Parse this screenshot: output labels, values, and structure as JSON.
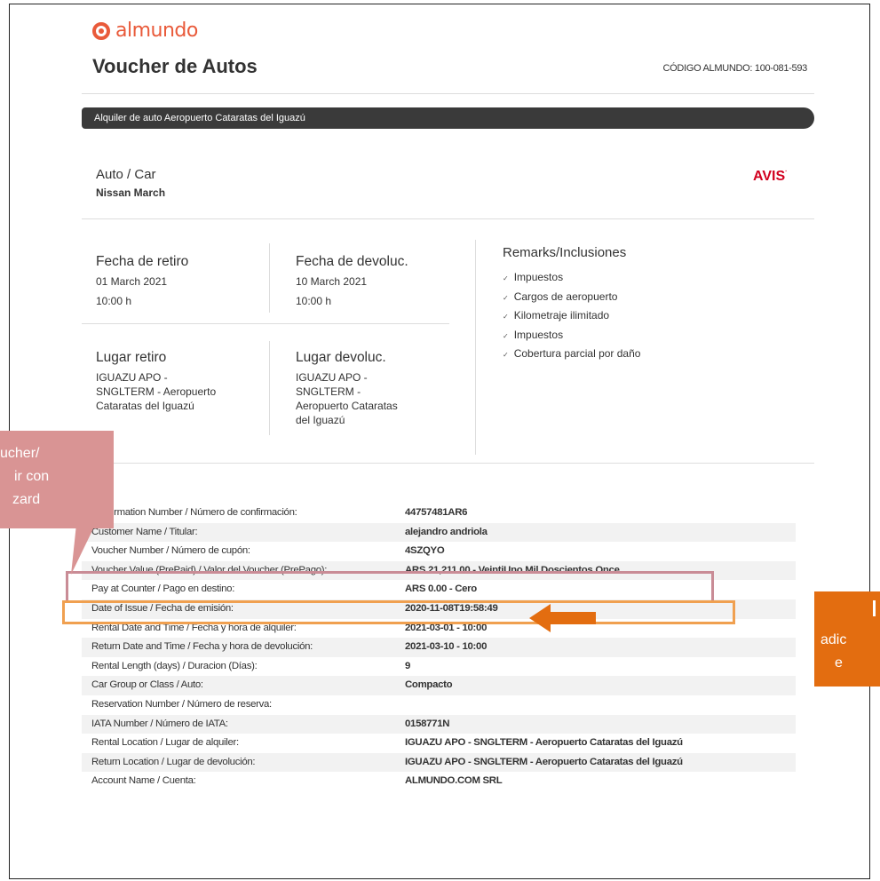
{
  "brand": {
    "name": "almundo"
  },
  "header": {
    "title": "Voucher de Autos",
    "code": "CÓDIGO ALMUNDO: 100-081-593"
  },
  "bar_title": "Alquiler de auto Aeropuerto Cataratas del Iguazú",
  "car": {
    "heading": "Auto / Car",
    "model": "Nissan March",
    "company": "AVIS"
  },
  "pickup": {
    "heading": "Fecha de retiro",
    "date": "01 March 2021",
    "time": "10:00 h",
    "place_heading": "Lugar retiro",
    "place": "IGUAZU APO -\nSNGLTERM - Aeropuerto\nCataratas del Iguazú"
  },
  "return": {
    "heading": "Fecha de devoluc.",
    "date": "10 March 2021",
    "time": "10:00 h",
    "place_heading": "Lugar devoluc.",
    "place": "IGUAZU APO -\nSNGLTERM -\nAeropuerto Cataratas\ndel Iguazú"
  },
  "remarks": {
    "heading": "Remarks/Inclusiones",
    "items": [
      "Impuestos",
      "Cargos de aeropuerto",
      "Kilometraje ilimitado",
      "Impuestos",
      "Cobertura parcial por daño"
    ]
  },
  "details": [
    {
      "label": "Confirmation Number / Número de confirmación:",
      "value": "44757481AR6"
    },
    {
      "label": "Customer Name / Titular:",
      "value": "alejandro andriola"
    },
    {
      "label": "Voucher Number / Número de cupón:",
      "value": "4SZQYO"
    },
    {
      "label": "Voucher Value (PrePaid) / Valor del Voucher (PrePago):",
      "value": "ARS 21,211.00 - VeintiUno Mil Doscientos Once"
    },
    {
      "label": "Pay at Counter / Pago en destino:",
      "value": "ARS 0.00 - Cero"
    },
    {
      "label": "Date of Issue / Fecha de emisión:",
      "value": "2020-11-08T19:58:49"
    },
    {
      "label": "Rental Date and Time / Fecha y hora de alquiler:",
      "value": "2021-03-01 - 10:00"
    },
    {
      "label": "Return Date and Time / Fecha y hora de devolución:",
      "value": "2021-03-10 - 10:00"
    },
    {
      "label": "Rental Length (days) / Duracion (Días):",
      "value": "9"
    },
    {
      "label": "Car Group or Class / Auto:",
      "value": "Compacto"
    },
    {
      "label": "Reservation Number / Número de reserva:",
      "value": ""
    },
    {
      "label": "IATA Number / Número de IATA:",
      "value": "0158771N"
    },
    {
      "label": "Rental Location / Lugar de alquiler:",
      "value": "IGUAZU APO - SNGLTERM - Aeropuerto Cataratas del Iguazú"
    },
    {
      "label": "Return Location / Lugar de devolución:",
      "value": "IGUAZU APO - SNGLTERM - Aeropuerto Cataratas del Iguazú"
    },
    {
      "label": "Account Name / Cuenta:",
      "value": "ALMUNDO.COM SRL"
    }
  ],
  "annotations": {
    "left": [
      "ucher/",
      "ir con",
      "zard"
    ],
    "right": [
      "adic",
      "e"
    ]
  },
  "colors": {
    "brand": "#e95a3a",
    "avis": "#d2001f",
    "highlight_pink": "#d99494",
    "highlight_orange": "#e36d10"
  }
}
